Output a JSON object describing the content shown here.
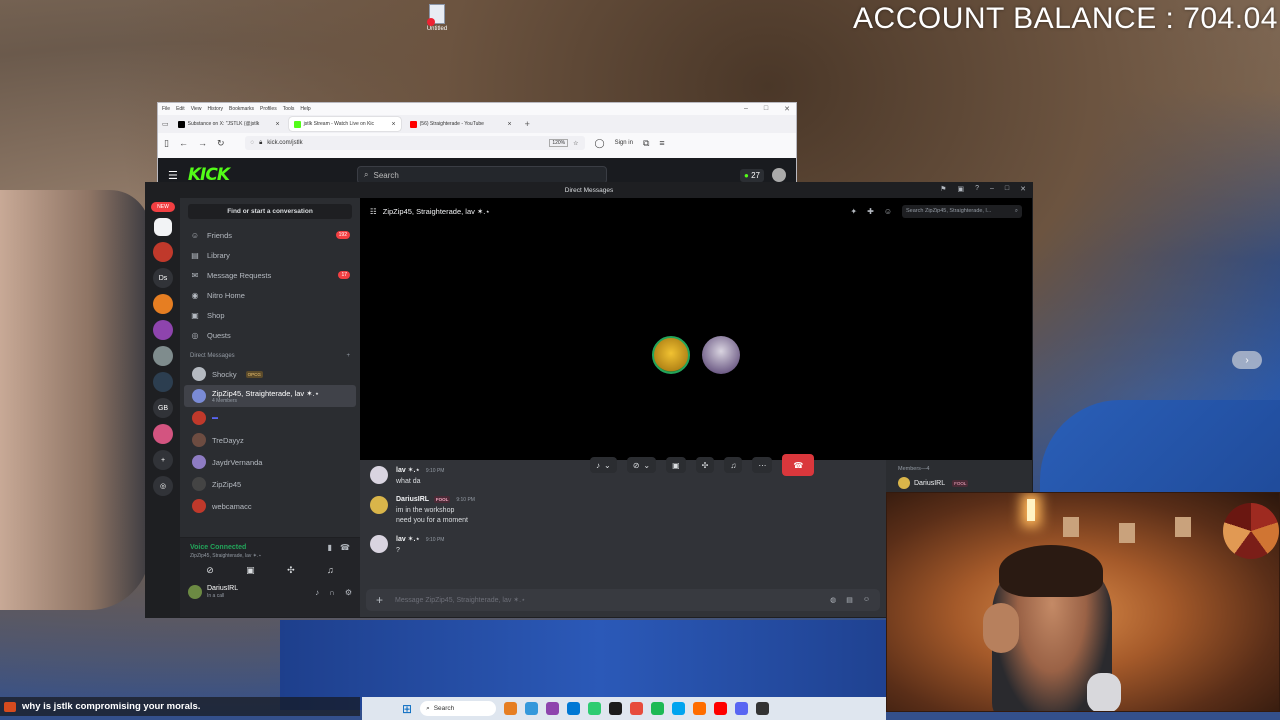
{
  "overlay": {
    "account_balance": "ACCOUNT BALANCE : 704.04",
    "desktop_icon_label": "Untitled",
    "chat_message": "why is jstlk compromising your morals."
  },
  "browser": {
    "menu": [
      "File",
      "Edit",
      "View",
      "History",
      "Bookmarks",
      "Profiles",
      "Tools",
      "Help"
    ],
    "tabs": [
      {
        "title": "Substance on X: \"JSTLK (@jstlk",
        "color": "#000000"
      },
      {
        "title": "jstlk Stream - Watch Live on Kic",
        "color": "#53fc18"
      },
      {
        "title": "(56) Straighterade - YouTube",
        "color": "#ff0000"
      }
    ],
    "url": "kick.com/jstlk",
    "zoom": "120%",
    "sign_in": "Sign in",
    "kick": {
      "logo": "KICK",
      "search_placeholder": "Search",
      "badge_count": "27"
    }
  },
  "discord": {
    "window_title": "Direct Messages",
    "servers": [
      "NEW",
      "Ds",
      "GB"
    ],
    "find_button": "Find or start a conversation",
    "nav": [
      {
        "label": "Friends",
        "icon": "friends-icon",
        "badge": "192"
      },
      {
        "label": "Library",
        "icon": "library-icon",
        "badge": ""
      },
      {
        "label": "Message Requests",
        "icon": "mail-icon",
        "badge": "17"
      },
      {
        "label": "Nitro Home",
        "icon": "nitro-icon",
        "badge": ""
      },
      {
        "label": "Shop",
        "icon": "shop-icon",
        "badge": ""
      },
      {
        "label": "Quests",
        "icon": "quests-icon",
        "badge": ""
      }
    ],
    "dm_header": "Direct Messages",
    "dms": [
      {
        "name": "Shocky",
        "sub": "",
        "tag": "OPCG",
        "color": "#b5bac1"
      },
      {
        "name": "ZipZip45, Straighterade, lav ✶.⋆",
        "sub": "4 Members",
        "tag": "",
        "color": "#7a8bd6"
      },
      {
        "name": "",
        "sub": "",
        "tag": "",
        "color": "#c0392b"
      },
      {
        "name": "TreDayyz",
        "sub": "",
        "tag": "",
        "color": "#6d4c41"
      },
      {
        "name": "JaydrVernanda",
        "sub": "",
        "tag": "",
        "color": "#8e7cc3"
      },
      {
        "name": "ZipZip45",
        "sub": "",
        "tag": "",
        "color": "#444"
      },
      {
        "name": "webcamacc",
        "sub": "",
        "tag": "",
        "color": "#c0392b"
      }
    ],
    "voice": {
      "status": "Voice Connected",
      "channel": "ZipZip45, Straighterade, lav ✶.⋆"
    },
    "user": {
      "name": "DariusIRL",
      "status": "In a call"
    },
    "channel_title": "ZipZip45, Straighterade, lav ✶.⋆",
    "search_placeholder": "Search ZipZip45, Straighterade, l...",
    "messages": [
      {
        "author": "lav ✶.⋆",
        "time": "9:10 PM",
        "lines": [
          "what da"
        ],
        "tag": "",
        "avatar_color": "#d9d4e0"
      },
      {
        "author": "DariusIRL",
        "time": "9:10 PM",
        "lines": [
          "im in the workshop",
          "need you for a moment"
        ],
        "tag": "FOOL",
        "avatar_color": "#d9b54a"
      },
      {
        "author": "lav ✶.⋆",
        "time": "9:10 PM",
        "lines": [
          "?"
        ],
        "tag": "",
        "avatar_color": "#d9d4e0"
      }
    ],
    "composer_placeholder": "Message ZipZip45, Straighterade, lav ✶.⋆",
    "members_header": "Members—4",
    "members": [
      {
        "name": "DariusIRL",
        "tag": "FOOL"
      }
    ]
  },
  "taskbar": {
    "search_label": "Search",
    "apps": [
      "#e67e22",
      "#3498db",
      "#8e44ad",
      "#0078d4",
      "#2ecc71",
      "#1b1b1b",
      "#e74c3c",
      "#1db954",
      "#00a4ef",
      "#ff6d00",
      "#ff0000",
      "#5865f2",
      "#333333"
    ]
  }
}
